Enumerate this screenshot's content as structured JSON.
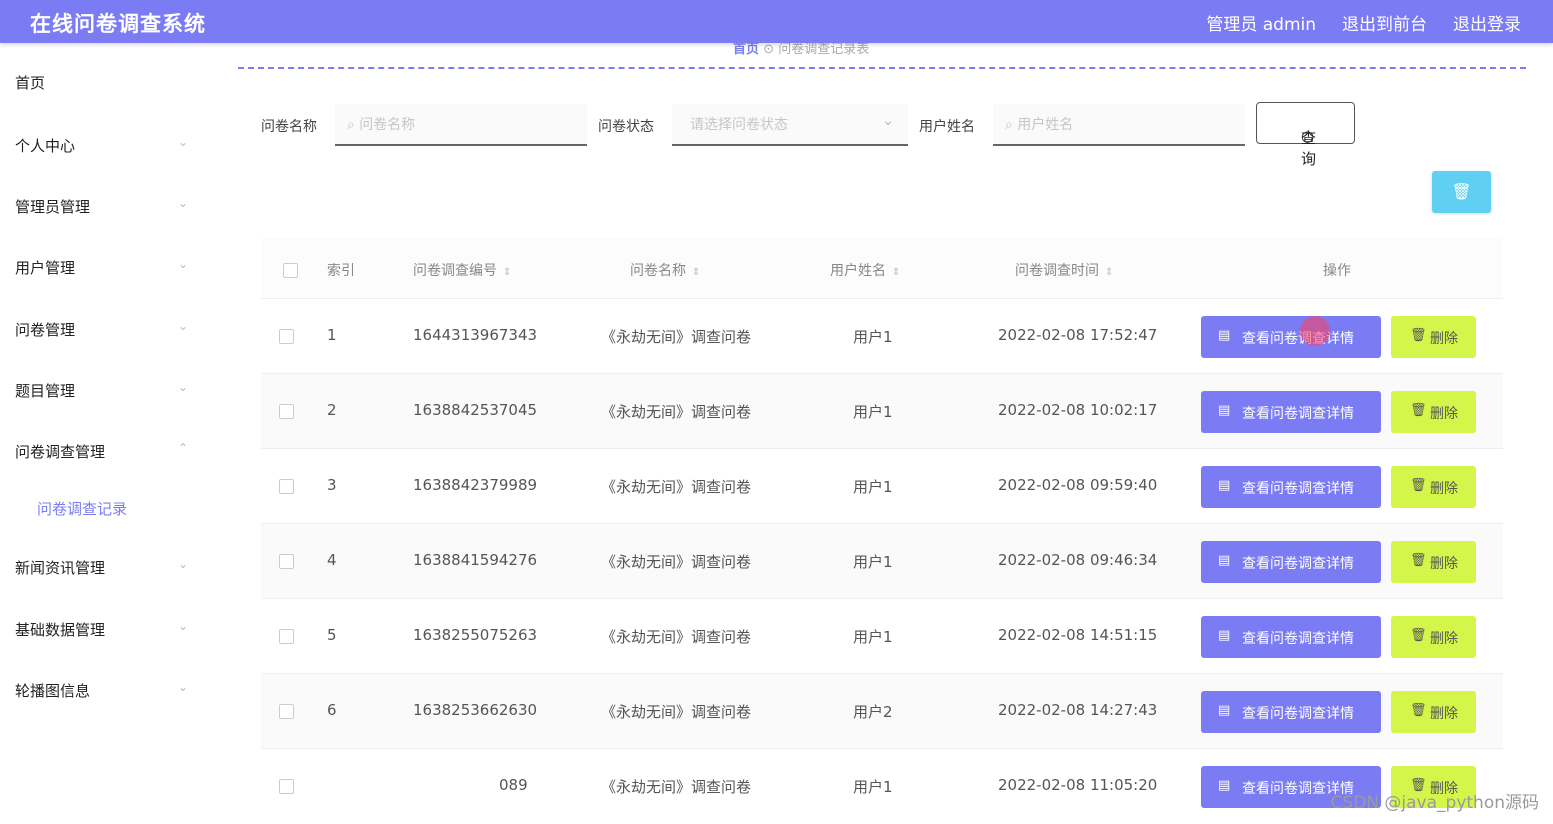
{
  "header": {
    "title": "在线问卷调查系统",
    "links": [
      "管理员 admin",
      "退出到前台",
      "退出登录"
    ]
  },
  "sidebar": {
    "items": [
      {
        "label": "首页"
      },
      {
        "label": "个人中心"
      },
      {
        "label": "管理员管理"
      },
      {
        "label": "用户管理"
      },
      {
        "label": "问卷管理"
      },
      {
        "label": "题目管理"
      },
      {
        "label": "问卷调查管理"
      },
      {
        "label": "问卷调查记录"
      },
      {
        "label": "新闻资讯管理"
      },
      {
        "label": "基础数据管理"
      },
      {
        "label": "轮播图信息"
      }
    ]
  },
  "breadcrumb": {
    "home": "首页",
    "current": "问卷调查记录表"
  },
  "filters": {
    "name_label": "问卷名称",
    "name_placeholder": "问卷名称",
    "status_label": "问卷状态",
    "status_placeholder": "请选择问卷状态",
    "user_label": "用户姓名",
    "user_placeholder": "用户姓名",
    "search_label": "查询"
  },
  "table": {
    "columns": [
      "索引",
      "问卷调查编号",
      "问卷名称",
      "用户姓名",
      "问卷调查时间",
      "操作"
    ],
    "detail_label": "查看问卷调查详情",
    "delete_label": "删除",
    "rows": [
      {
        "index": "1",
        "code": "1644313967343",
        "name": "《永劫无间》调查问卷",
        "user": "用户1",
        "time": "2022-02-08 17:52:47"
      },
      {
        "index": "2",
        "code": "1638842537045",
        "name": "《永劫无间》调查问卷",
        "user": "用户1",
        "time": "2022-02-08 10:02:17"
      },
      {
        "index": "3",
        "code": "1638842379989",
        "name": "《永劫无间》调查问卷",
        "user": "用户1",
        "time": "2022-02-08 09:59:40"
      },
      {
        "index": "4",
        "code": "1638841594276",
        "name": "《永劫无间》调查问卷",
        "user": "用户1",
        "time": "2022-02-08 09:46:34"
      },
      {
        "index": "5",
        "code": "1638255075263",
        "name": "《永劫无间》调查问卷",
        "user": "用户1",
        "time": "2022-02-08 14:51:15"
      },
      {
        "index": "6",
        "code": "1638253662630",
        "name": "《永劫无间》调查问卷",
        "user": "用户2",
        "time": "2022-02-08 14:27:43"
      },
      {
        "index": "",
        "code": "089",
        "name": "《永劫无间》调查问卷",
        "user": "用户1",
        "time": "2022-02-08 11:05:20"
      }
    ]
  },
  "watermark": "CSDN @java_python源码"
}
